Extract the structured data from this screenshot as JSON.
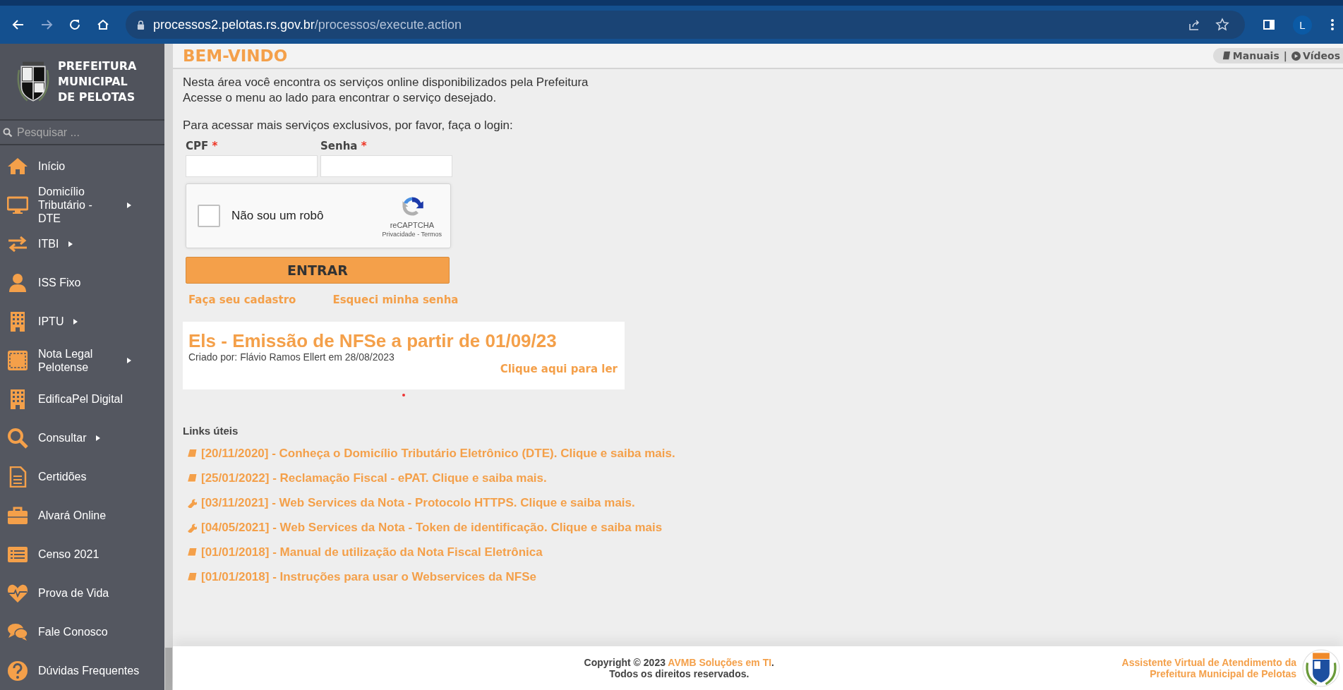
{
  "browser": {
    "url_host": "processos2.pelotas.rs.gov.br",
    "url_path": "/processos/execute.action",
    "profile_initial": "L"
  },
  "sidebar": {
    "logo_lines": [
      "PREFEITURA",
      "MUNICIPAL",
      "DE PELOTAS"
    ],
    "search": {
      "placeholder": "Pesquisar ..."
    },
    "items": [
      {
        "label": "Início",
        "kind": "home",
        "submenu": false
      },
      {
        "label": "Domicílio Tributário - DTE",
        "kind": "monitor",
        "submenu": true
      },
      {
        "label": "ITBI",
        "kind": "arrows",
        "submenu": true
      },
      {
        "label": "ISS Fixo",
        "kind": "person",
        "submenu": false
      },
      {
        "label": "IPTU",
        "kind": "building",
        "submenu": true
      },
      {
        "label": "Nota Legal Pelotense",
        "kind": "nota",
        "submenu": true
      },
      {
        "label": "EdificaPel Digital",
        "kind": "building",
        "submenu": false
      },
      {
        "label": "Consultar",
        "kind": "search",
        "submenu": true
      },
      {
        "label": "Certidões",
        "kind": "document",
        "submenu": false
      },
      {
        "label": "Alvará Online",
        "kind": "briefcase",
        "submenu": false
      },
      {
        "label": "Censo 2021",
        "kind": "list",
        "submenu": false
      },
      {
        "label": "Prova de Vida",
        "kind": "heart",
        "submenu": false
      },
      {
        "label": "Fale Conosco",
        "kind": "chat",
        "submenu": false
      },
      {
        "label": "Dúvidas Frequentes",
        "kind": "question",
        "submenu": false
      }
    ]
  },
  "header": {
    "title": "BEM-VINDO",
    "manuals": "Manuais",
    "separator": "|",
    "videos": "Vídeos"
  },
  "intro": [
    "Nesta área você encontra os serviços online disponibilizados pela Prefeitura",
    "Acesse o menu ao lado para encontrar o serviço desejado."
  ],
  "login": {
    "prompt": "Para acessar mais serviços exclusivos, por favor, faça o login:",
    "fields": [
      {
        "label": "CPF",
        "required_mark": "*"
      },
      {
        "label": "Senha",
        "required_mark": "*"
      }
    ],
    "captcha": {
      "label": "Não sou um robô",
      "checked": false,
      "brand": "reCAPTCHA",
      "privacy": "Privacidade",
      "separator": "-",
      "terms": "Termos"
    },
    "submit": "ENTRAR",
    "links": [
      "Faça seu cadastro",
      "Esqueci minha senha"
    ]
  },
  "news": {
    "title": "Els - Emissão de NFSe a partir de 01/09/23",
    "byline": "Criado por: Flávio Ramos Ellert em 28/08/2023",
    "read_more": "Clique aqui para ler"
  },
  "useful_links": {
    "title": "Links úteis",
    "items": [
      {
        "kind": "book",
        "text": "[20/11/2020] - Conheça o Domicílio Tributário Eletrônico (DTE). Clique e saiba mais."
      },
      {
        "kind": "book",
        "text": "[25/01/2022] - Reclamação Fiscal - ePAT. Clique e saiba mais."
      },
      {
        "kind": "wrench",
        "text": "[03/11/2021] - Web Services da Nota - Protocolo HTTPS. Clique e saiba mais."
      },
      {
        "kind": "wrench",
        "text": "[04/05/2021] - Web Services da Nota - Token de identificação. Clique e saiba mais"
      },
      {
        "kind": "book",
        "text": "[01/01/2018] - Manual de utilização da Nota Fiscal Eletrônica"
      },
      {
        "kind": "book",
        "text": "[01/01/2018] - Instruções para usar o Webservices da NFSe"
      }
    ]
  },
  "footer": {
    "copyright": "Copyright © 2023",
    "company": "AVMB Soluções em TI",
    "period": ".",
    "rights": "Todos os direitos reservados.",
    "assistant_lines": [
      "Assistente Virtual de Atendimento da",
      "Prefeitura Municipal de Pelotas"
    ]
  }
}
